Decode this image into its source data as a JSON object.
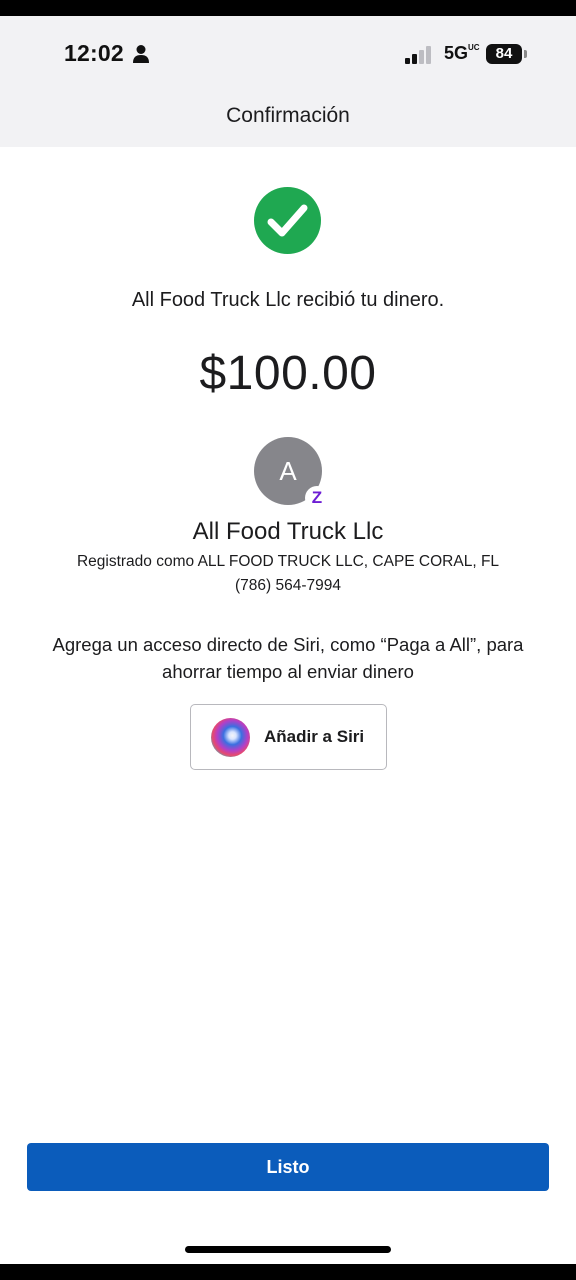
{
  "status_bar": {
    "time": "12:02",
    "network": "5G",
    "network_sub": "UC",
    "battery": "84"
  },
  "header": {
    "title": "Confirmación"
  },
  "confirmation": {
    "message": "All Food Truck Llc recibió tu dinero.",
    "amount": "$100.00"
  },
  "recipient": {
    "initial": "A",
    "badge": "Z",
    "name": "All Food Truck Llc",
    "registered_as": "Registrado como ALL FOOD TRUCK LLC, CAPE CORAL, FL",
    "phone": "(786) 564-7994"
  },
  "siri": {
    "hint": "Agrega un acceso directo de Siri, como “Paga a All”, para ahorrar tiempo al enviar dinero",
    "button_label": "Añadir a Siri"
  },
  "footer": {
    "done_label": "Listo"
  },
  "colors": {
    "success_green": "#1fa851",
    "primary_blue": "#0b5cbb",
    "zelle_purple": "#6d1ed4",
    "avatar_gray": "#86868b",
    "header_bg": "#f2f2f4"
  },
  "icons": [
    "person-icon",
    "signal-bars-icon",
    "battery-icon",
    "checkmark-circle-icon",
    "zelle-badge-icon",
    "siri-icon"
  ]
}
